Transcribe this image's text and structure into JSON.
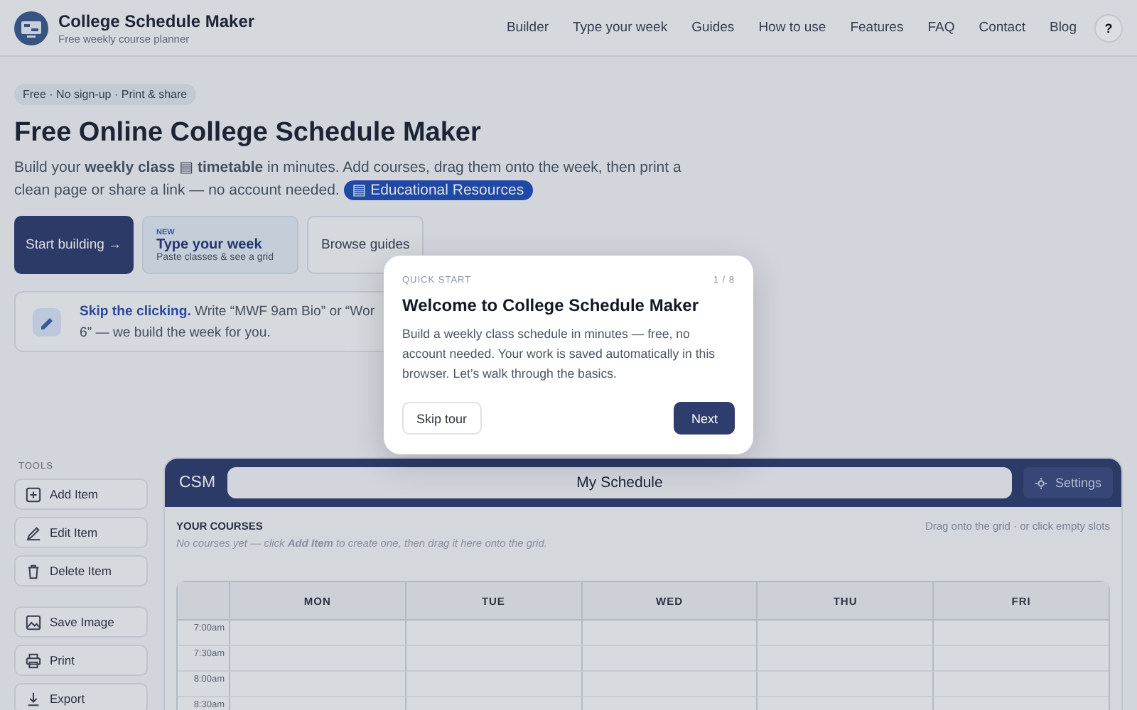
{
  "header": {
    "title": "College Schedule Maker",
    "subtitle": "Free weekly course planner",
    "nav": [
      {
        "label": "Builder"
      },
      {
        "label": "Type your week"
      },
      {
        "label": "Guides"
      },
      {
        "label": "How to use"
      },
      {
        "label": "Features"
      },
      {
        "label": "FAQ"
      },
      {
        "label": "Contact"
      },
      {
        "label": "Blog"
      }
    ],
    "help": "?"
  },
  "hero": {
    "badge": "Free · No sign-up · Print & share",
    "title": "Free Online College Schedule Maker",
    "intro": "Build your **weekly class** ▤ **timetable** in minutes. Add courses, drag them onto the week, then print a clean page or share a link — no account needed.",
    "resource_link": "▤ Educational Resources",
    "actions": [
      {
        "kind": "primary",
        "label": "Start building →"
      },
      {
        "kind": "feature",
        "tag": "NEW",
        "label": "Type your week",
        "sub": "Paste classes & see a grid"
      },
      {
        "kind": "secondary",
        "label": "Browse guides"
      }
    ],
    "tip": {
      "lines": [
        "**Skip the clicking.** Write “MWF 9am Bio” or “Wor",
        "6” — we build the week for you."
      ]
    }
  },
  "tools": {
    "heading": "TOOLS",
    "groups": [
      [
        {
          "kind": "add",
          "label": "Add Item"
        },
        {
          "kind": "edit",
          "label": "Edit Item"
        },
        {
          "kind": "delete",
          "label": "Delete Item"
        }
      ],
      [
        {
          "kind": "image",
          "label": "Save Image"
        },
        {
          "kind": "print",
          "label": "Print"
        },
        {
          "kind": "export",
          "label": "Export"
        }
      ]
    ]
  },
  "schedule": {
    "logo": "CSM",
    "name": "My Schedule",
    "settings": "Settings",
    "courses_heading": "YOUR COURSES",
    "empty_hint": "No courses yet — click **Add Item** to create one, then drag it here onto the grid.",
    "drag_hint": "Drag onto the grid · or click empty slots",
    "days": [
      "MON",
      "TUE",
      "WED",
      "THU",
      "FRI"
    ],
    "times": [
      "7:00am",
      "7:30am",
      "8:00am",
      "8:30am"
    ]
  },
  "tour": {
    "label": "QUICK START",
    "step": "1 / 8",
    "title": "Welcome to College Schedule Maker",
    "body": "Build a weekly class schedule in minutes — free, no account needed. Your work is saved automatically in this browser. Let’s walk through the basics.",
    "buttons": [
      {
        "kind": "secondary",
        "label": "Skip tour"
      },
      {
        "kind": "primary",
        "label": "Next"
      }
    ]
  }
}
